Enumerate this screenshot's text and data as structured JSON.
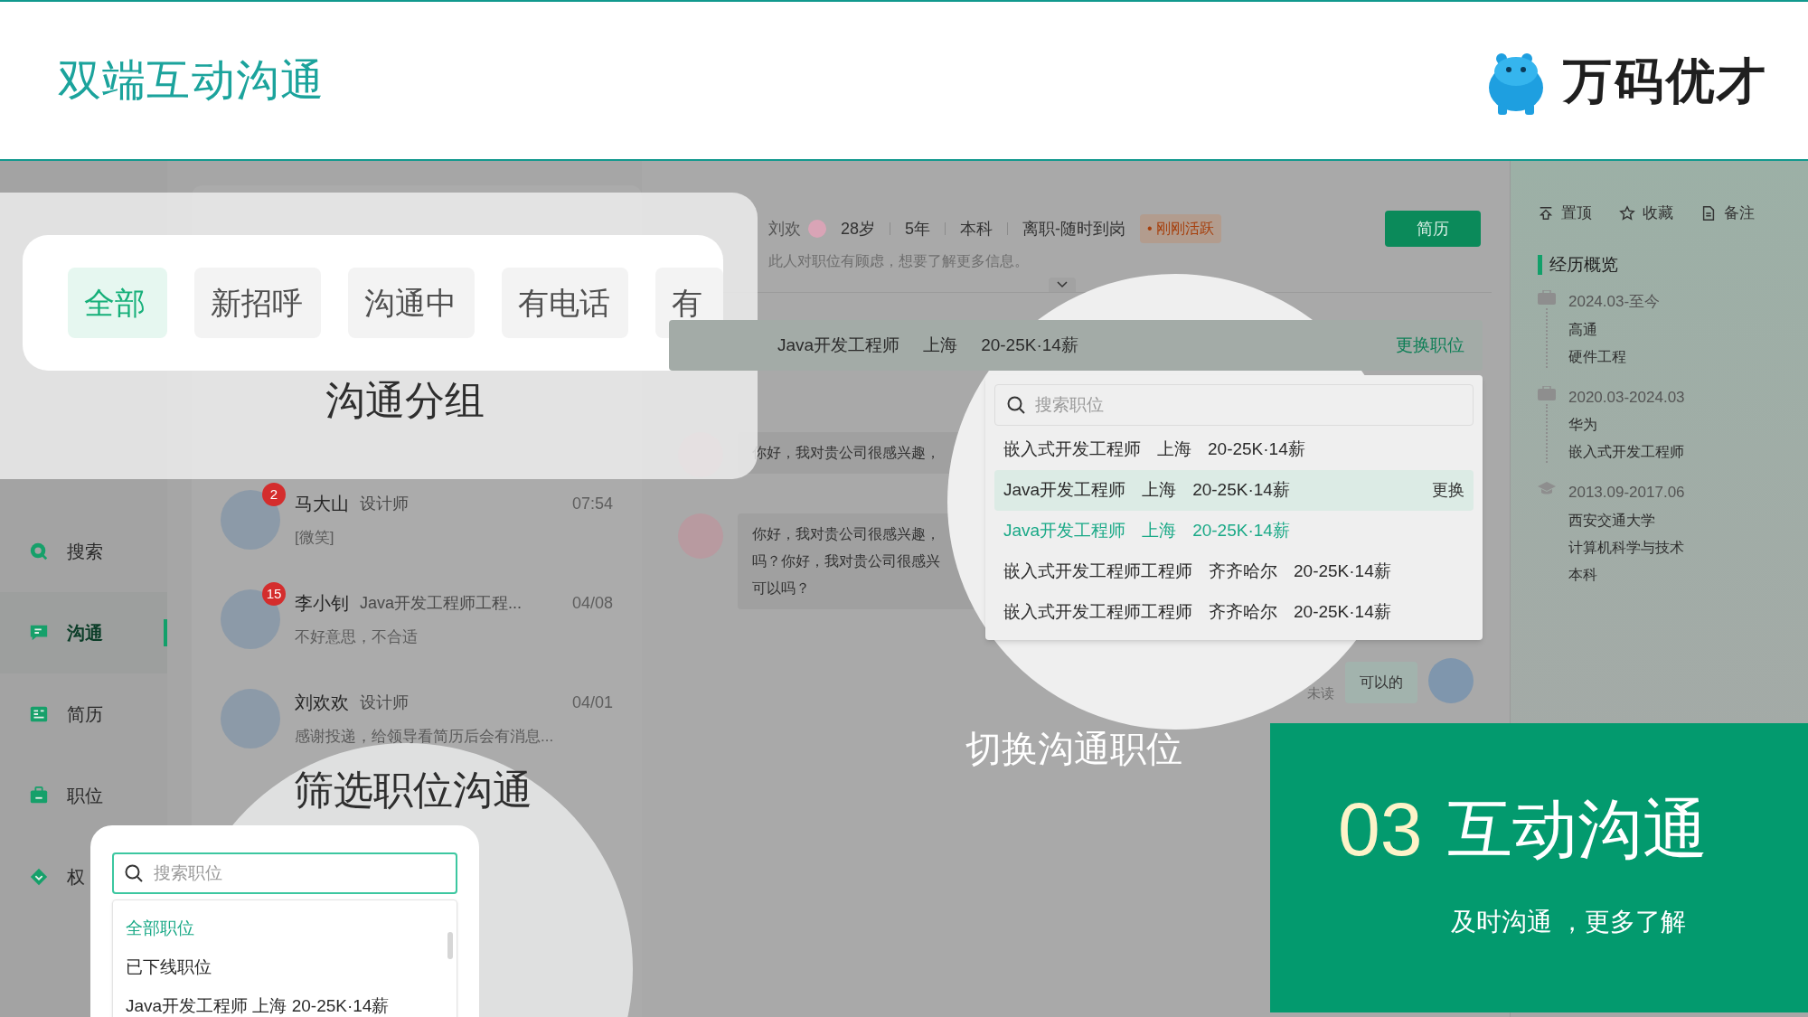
{
  "header": {
    "title": "双端互动沟通",
    "logo_text": "万码优才"
  },
  "sidebar": {
    "items": [
      {
        "label": "搜索",
        "selected": false
      },
      {
        "label": "沟通",
        "selected": true
      },
      {
        "label": "简历",
        "selected": false
      },
      {
        "label": "职位",
        "selected": false
      },
      {
        "label": "权",
        "selected": false
      }
    ]
  },
  "chat_list": {
    "rows": [
      {
        "name": "马大山",
        "role": "设计师",
        "time": "07:54",
        "preview": "[微笑]",
        "unread": "2"
      },
      {
        "name": "李小钊",
        "role": "Java开发工程师工程...",
        "time": "04/08",
        "preview": "不好意思，不合适",
        "unread": "15"
      },
      {
        "name": "刘欢欢",
        "role": "设计师",
        "time": "04/01",
        "preview": "感谢投递，给领导看简历后会有消息..."
      }
    ]
  },
  "group_callout": {
    "label": "沟通分组",
    "tabs": [
      {
        "label": "全部",
        "selected": true
      },
      {
        "label": "新招呼",
        "selected": false
      },
      {
        "label": "沟通中",
        "selected": false
      },
      {
        "label": "有电话",
        "selected": false
      },
      {
        "label": "有",
        "selected": false
      }
    ]
  },
  "filter_callout": {
    "label": "筛选职位沟通",
    "search": {
      "placeholder": "搜索职位"
    },
    "options": [
      {
        "label": "全部职位",
        "selected": true
      },
      {
        "label": "已下线职位",
        "selected": false
      },
      {
        "label": "Java开发工程师 上海 20-25K·14薪",
        "selected": false
      }
    ]
  },
  "chat": {
    "candidate": {
      "name": "刘欢",
      "facts": [
        "28岁",
        "5年",
        "本科",
        "离职-随时到岗"
      ],
      "status": "• 刚刚活跃",
      "resume_button": "简历",
      "note": "此人对职位有顾虑，想要了解更多信息。"
    },
    "job_bar": {
      "title": "Java开发工程师",
      "city": "上海",
      "salary": "20-25K·14薪",
      "action": "更换职位"
    },
    "messages": [
      {
        "kind": "received",
        "lines": [
          "你好，我对贵公司很感兴趣，"
        ]
      },
      {
        "kind": "received",
        "lines": [
          "你好，我对贵公司很感兴趣，",
          "吗？你好，我对贵公司很感兴",
          "可以吗？"
        ]
      },
      {
        "kind": "sent",
        "lines": [
          "可以的"
        ],
        "receipt": "未读"
      }
    ]
  },
  "switch_callout": {
    "label": "切换沟通职位",
    "search": {
      "placeholder": "搜索职位"
    },
    "options": [
      {
        "title": "嵌入式开发工程师",
        "city": "上海",
        "salary": "20-25K·14薪",
        "selected": false,
        "hovered": false
      },
      {
        "title": "Java开发工程师",
        "city": "上海",
        "salary": "20-25K·14薪",
        "selected": false,
        "hovered": true,
        "action": "更换"
      },
      {
        "title": "Java开发工程师",
        "city": "上海",
        "salary": "20-25K·14薪",
        "selected": true,
        "hovered": false
      },
      {
        "title": "嵌入式开发工程师工程师",
        "city": "齐齐哈尔",
        "salary": "20-25K·14薪",
        "selected": false,
        "hovered": false
      },
      {
        "title": "嵌入式开发工程师工程师",
        "city": "齐齐哈尔",
        "salary": "20-25K·14薪",
        "selected": false,
        "hovered": false
      }
    ]
  },
  "profile": {
    "actions": [
      "置顶",
      "收藏",
      "备注"
    ],
    "section": "经历概览",
    "timeline": [
      {
        "kind": "work",
        "period": "2024.03-至今",
        "lines": [
          "高通",
          "硬件工程"
        ]
      },
      {
        "kind": "work",
        "period": "2020.03-2024.03",
        "lines": [
          "华为",
          "嵌入式开发工程师"
        ]
      },
      {
        "kind": "education",
        "period": "2013.09-2017.06",
        "lines": [
          "西安交通大学",
          "计算机科学与技术",
          "本科"
        ]
      }
    ]
  },
  "promo": {
    "number": "03",
    "title": "互动沟通",
    "subtitle": "及时沟通 ，更多了解"
  }
}
